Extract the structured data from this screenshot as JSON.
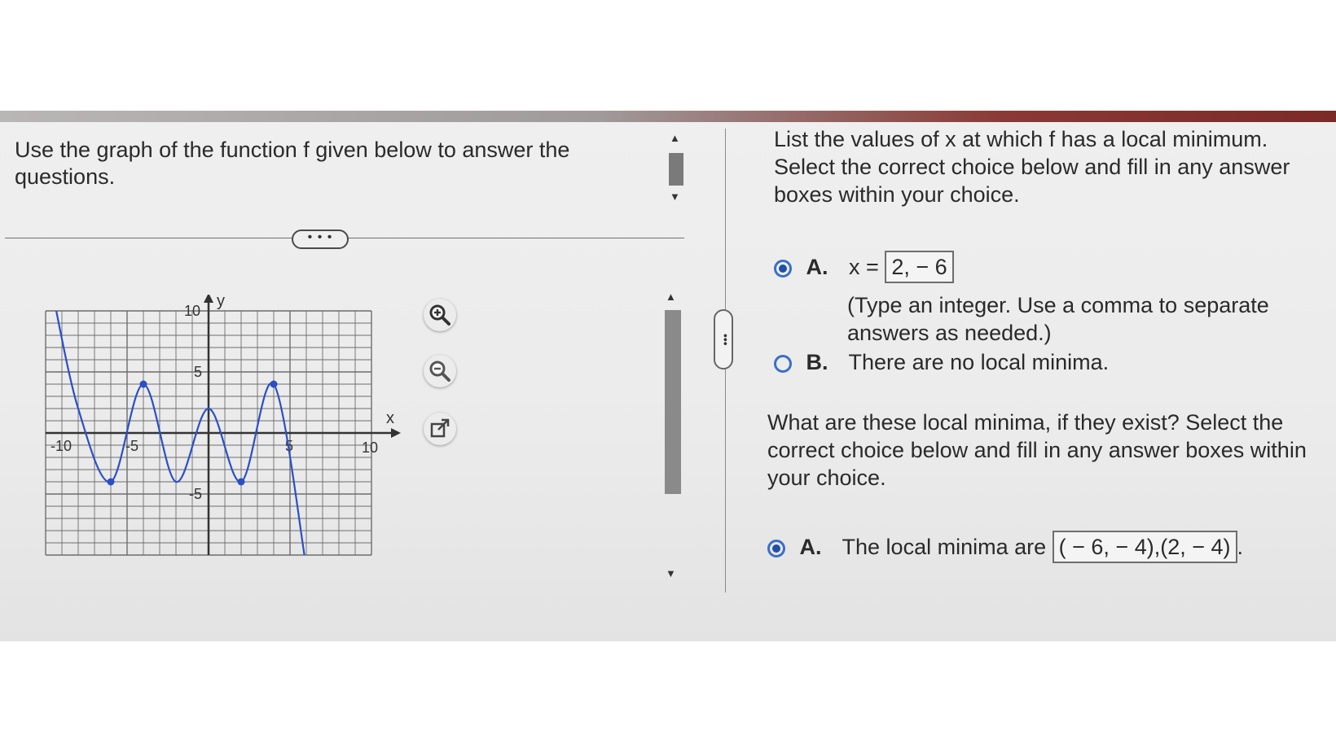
{
  "left": {
    "question": "Use the graph of the function f given below to answer the questions.",
    "expand_label": "• • •"
  },
  "graph": {
    "x_label": "x",
    "y_label": "y",
    "ticks": {
      "x_neg10": "-10",
      "x_neg5": "-5",
      "x_5": "5",
      "x_10": "10",
      "y_10": "10",
      "y_5": "5",
      "y_neg5": "-5"
    },
    "curve": {
      "x": [
        -9.5,
        -8,
        -6,
        -4,
        -2,
        0,
        2,
        4,
        6
      ],
      "y": [
        11,
        2,
        -4,
        4,
        -4,
        2,
        -4,
        4,
        -11
      ]
    },
    "highlighted_points": [
      {
        "x": -6,
        "y": -4
      },
      {
        "x": -4,
        "y": 4
      },
      {
        "x": 2,
        "y": -4
      },
      {
        "x": 4,
        "y": 4
      }
    ],
    "xlim": [
      -10,
      10
    ],
    "ylim": [
      -10,
      10
    ],
    "colors": {
      "curve": "#2b4fc4",
      "grid": "#6d6d6d",
      "axis": "#333333"
    }
  },
  "tools": {
    "zoom_in": "zoom-in-icon",
    "zoom_out": "zoom-out-icon",
    "popout": "popout-icon"
  },
  "right": {
    "q1": "List the values of x at which f has a local minimum. Select the correct choice below and fill in any answer boxes within your choice.",
    "q1_options": {
      "a_letter": "A.",
      "a_prefix": "x =",
      "a_value": "2, − 6",
      "a_hint": "(Type an integer. Use a comma to separate answers as needed.)",
      "b_letter": "B.",
      "b_text": "There are no local minima."
    },
    "q2": "What are these local minima, if they exist? Select the correct choice below and fill in any answer boxes within your choice.",
    "q2_options": {
      "a_letter": "A.",
      "a_prefix": "The local minima are",
      "a_value": "( − 6, − 4),(2, − 4)",
      "a_suffix": "."
    }
  }
}
